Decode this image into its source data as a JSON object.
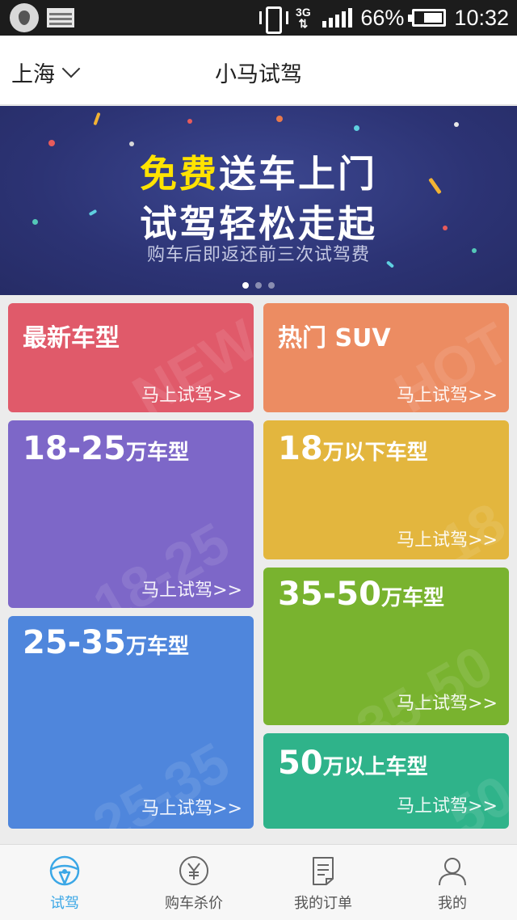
{
  "status_bar": {
    "network": "3G",
    "battery": "66%",
    "time": "10:32",
    "icons": [
      "app-drop-icon",
      "image-icon",
      "vibrate-icon",
      "network-icon",
      "signal-icon",
      "battery-icon"
    ]
  },
  "header": {
    "city": "上海",
    "title": "小马试驾"
  },
  "banner": {
    "line1_highlight": "免费",
    "line1_rest": "送车上门",
    "line2": "试驾轻松走起",
    "line3": "购车后即返还前三次试驾费",
    "page_count": 3,
    "active_page": 1
  },
  "tiles": {
    "newest": {
      "title": "最新车型",
      "cta": "马上试驾>>",
      "watermark": "NEW",
      "color": "#e05a6a"
    },
    "hot_suv": {
      "title": "热门 SUV",
      "cta": "马上试驾>>",
      "watermark": "HOT",
      "color": "#ec8c62"
    },
    "range_18_25": {
      "title_num": "18-25",
      "title_unit": "万车型",
      "cta": "马上试驾>>",
      "watermark": "18-25",
      "color": "#7d67c8"
    },
    "below_18": {
      "title_num": "18",
      "title_unit": "万以下车型",
      "cta": "马上试驾>>",
      "watermark": "18",
      "color": "#e3b63e"
    },
    "range_25_35": {
      "title_num": "25-35",
      "title_unit": "万车型",
      "cta": "马上试驾>>",
      "watermark": "25-35",
      "color": "#4f86dc"
    },
    "range_35_50": {
      "title_num": "35-50",
      "title_unit": "万车型",
      "cta": "马上试驾>>",
      "watermark": "35-50",
      "color": "#79b32f"
    },
    "above_50": {
      "title_num": "50",
      "title_unit": "万以上车型",
      "cta": "马上试驾>>",
      "watermark": "50",
      "color": "#2fb38a"
    }
  },
  "bottom_nav": [
    {
      "label": "试驾",
      "icon": "steering-wheel-icon",
      "active": true
    },
    {
      "label": "购车杀价",
      "icon": "yuan-coin-icon",
      "active": false
    },
    {
      "label": "我的订单",
      "icon": "order-list-icon",
      "active": false
    },
    {
      "label": "我的",
      "icon": "user-icon",
      "active": false
    }
  ],
  "colors": {
    "accent": "#3ba7e6",
    "banner_bg": "#2c3374",
    "highlight_yellow": "#ffe300"
  }
}
